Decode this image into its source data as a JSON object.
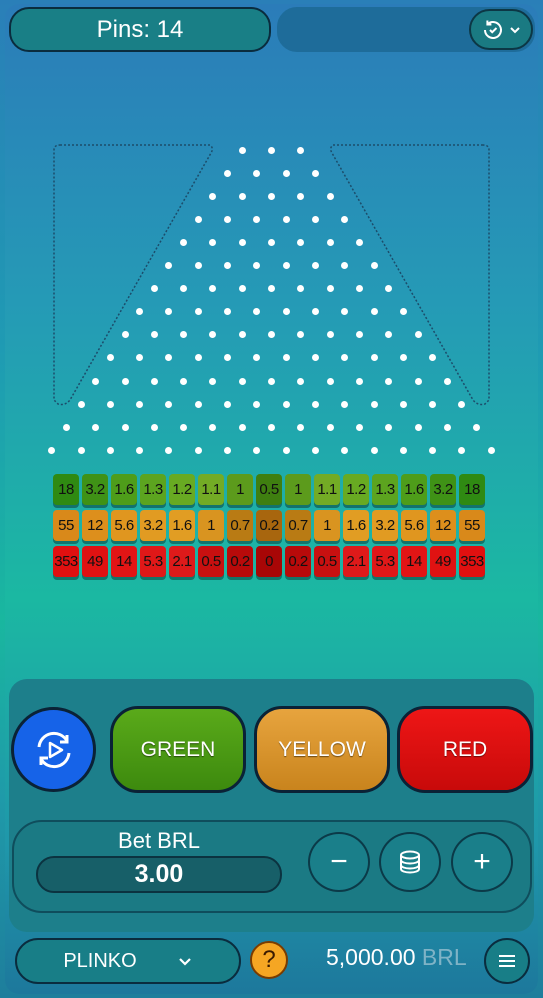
{
  "header": {
    "pins_label": "Pins: 14"
  },
  "board": {
    "pin_rows": 14,
    "multipliers": {
      "green": [
        "18",
        "3.2",
        "1.6",
        "1.3",
        "1.2",
        "1.1",
        "1",
        "0.5",
        "1",
        "1.1",
        "1.2",
        "1.3",
        "1.6",
        "3.2",
        "18"
      ],
      "yellow": [
        "55",
        "12",
        "5.6",
        "3.2",
        "1.6",
        "1",
        "0.7",
        "0.2",
        "0.7",
        "1",
        "1.6",
        "3.2",
        "5.6",
        "12",
        "55"
      ],
      "red": [
        "353",
        "49",
        "14",
        "5.3",
        "2.1",
        "0.5",
        "0.2",
        "0",
        "0.2",
        "0.5",
        "2.1",
        "5.3",
        "14",
        "49",
        "353"
      ]
    },
    "colors": {
      "green": [
        "#2f8a12",
        "#3f9216",
        "#4e9d1a",
        "#5ca41f",
        "#68aa22",
        "#73ab25",
        "#5c9b1c",
        "#3f7f10",
        "#5c9b1c",
        "#73ab25",
        "#68aa22",
        "#5ca41f",
        "#4e9d1a",
        "#3f9216",
        "#2f8a12"
      ],
      "yellow": [
        "#d9891a",
        "#dd8f1c",
        "#e0961f",
        "#e19b22",
        "#e19d23",
        "#d99420",
        "#b97b14",
        "#a8660e",
        "#b97b14",
        "#d99420",
        "#e19d23",
        "#e19b22",
        "#e0961f",
        "#dd8f1c",
        "#d9891a"
      ],
      "red": [
        "#e01010",
        "#e01212",
        "#e21515",
        "#e01818",
        "#de1a1a",
        "#c81010",
        "#b80a0a",
        "#a80606",
        "#b80a0a",
        "#c81010",
        "#de1a1a",
        "#e01818",
        "#e21515",
        "#e01212",
        "#e01010"
      ]
    }
  },
  "controls": {
    "green_label": "GREEN",
    "yellow_label": "YELLOW",
    "red_label": "RED",
    "bet_label": "Bet BRL",
    "bet_value": "3.00",
    "minus": "−",
    "plus": "+"
  },
  "footer": {
    "game_label": "PLINKO",
    "help": "?",
    "balance": "5,000.00",
    "currency": "BRL"
  },
  "icons": {
    "history": "history-icon",
    "autoplay": "autoplay-icon",
    "coins": "coins-icon",
    "menu": "menu-icon",
    "chevron": "chevron-down-icon"
  }
}
